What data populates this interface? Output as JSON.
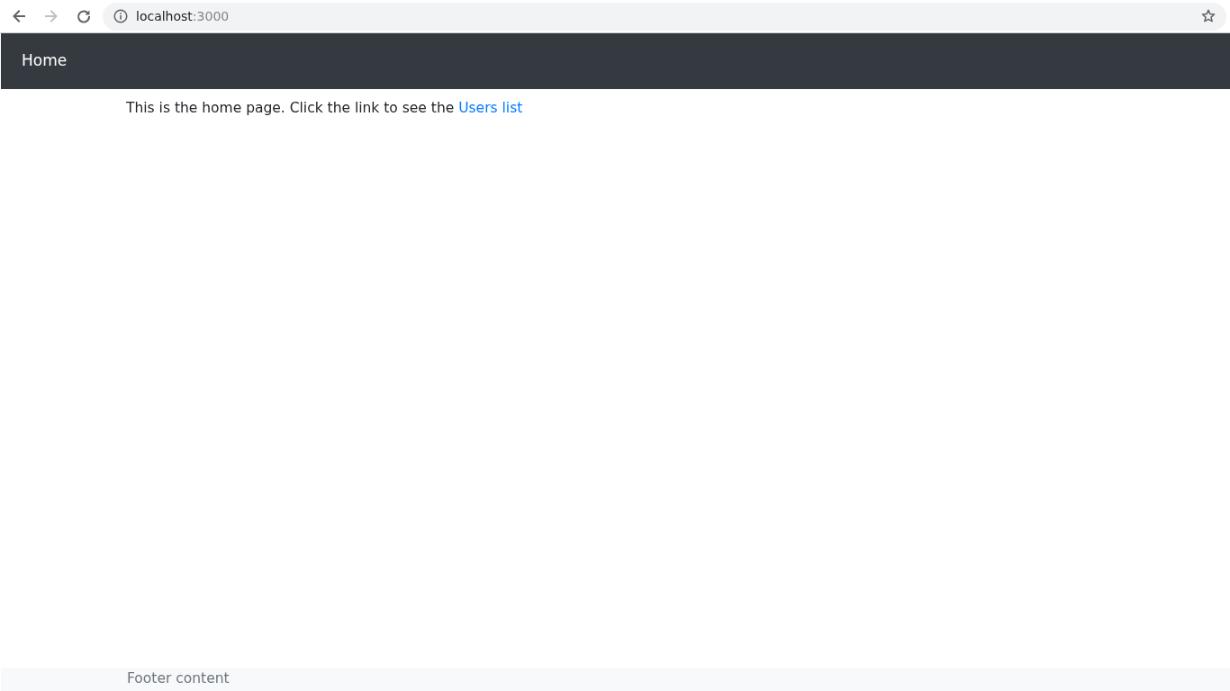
{
  "browser": {
    "buttons": [
      {
        "kind": "back",
        "disabled": false
      },
      {
        "kind": "forward",
        "disabled": true
      },
      {
        "kind": "reload",
        "disabled": false
      }
    ],
    "address": {
      "host": "localhost",
      "port": ":3000"
    }
  },
  "navbar": {
    "brand": "Home"
  },
  "content": {
    "text": "This is the home page. Click the link to see the",
    "link": "Users list"
  },
  "footer": {
    "text": "Footer content"
  }
}
